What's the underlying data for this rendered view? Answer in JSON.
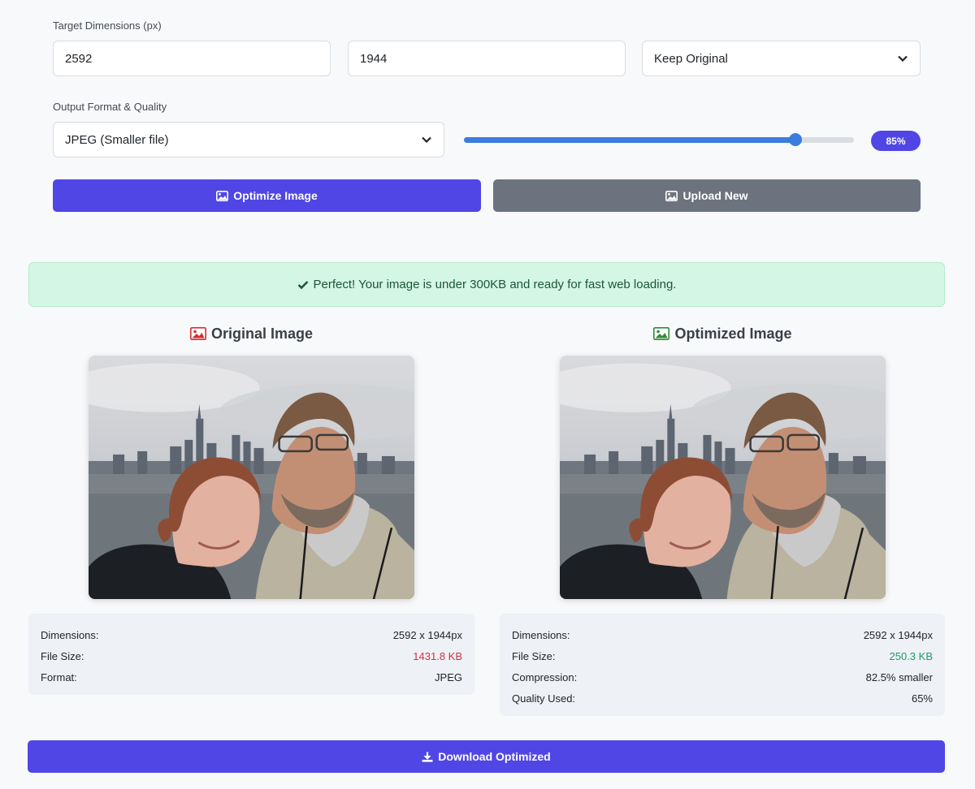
{
  "dimensions": {
    "label": "Target Dimensions (px)",
    "width_value": "2592",
    "height_value": "1944",
    "aspect_select": "Keep Original"
  },
  "format": {
    "label": "Output Format & Quality",
    "format_select": "JPEG (Smaller file)",
    "quality_percent": 85,
    "quality_label": "85%"
  },
  "actions": {
    "optimize_label": "Optimize Image",
    "upload_label": "Upload New",
    "download_label": "Download Optimized"
  },
  "alert": {
    "message": "Perfect! Your image is under 300KB and ready for fast web loading."
  },
  "original": {
    "title": "Original Image",
    "rows": [
      {
        "label": "Dimensions:",
        "value": "2592 x 1944px"
      },
      {
        "label": "File Size:",
        "value": "1431.8 KB"
      },
      {
        "label": "Format:",
        "value": "JPEG"
      }
    ]
  },
  "optimized": {
    "title": "Optimized Image",
    "rows": [
      {
        "label": "Dimensions:",
        "value": "2592 x 1944px"
      },
      {
        "label": "File Size:",
        "value": "250.3 KB"
      },
      {
        "label": "Compression:",
        "value": "82.5% smaller"
      },
      {
        "label": "Quality Used:",
        "value": "65%"
      }
    ]
  },
  "colors": {
    "primary": "#5046e5",
    "secondary": "#6c737e",
    "danger_text": "#d3313f",
    "success_text": "#1f9961",
    "alert_bg": "#d4f6e4"
  },
  "icons": {
    "image": "image-icon",
    "check": "check-icon",
    "download": "download-icon",
    "chevron": "chevron-down-icon"
  }
}
